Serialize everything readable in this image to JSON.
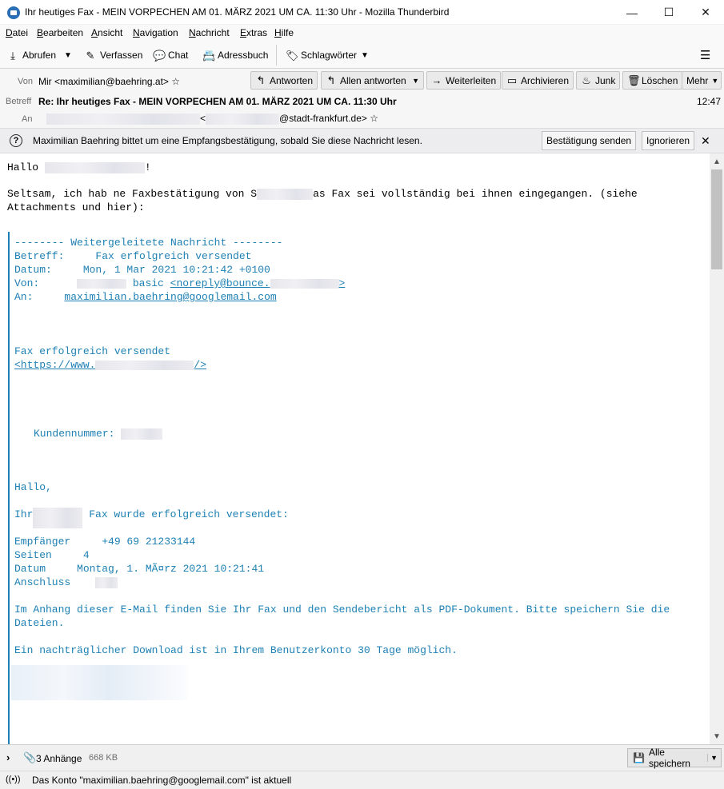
{
  "window": {
    "title": "Ihr heutiges Fax - MEIN VORPECHEN AM 01. MÄRZ 2021 UM CA. 11:30 Uhr - Mozilla Thunderbird",
    "minimize_glyph": "—",
    "maximize_glyph": "☐",
    "close_glyph": "✕"
  },
  "menu": {
    "items": [
      {
        "acc": "D",
        "rest": "atei"
      },
      {
        "acc": "B",
        "rest": "earbeiten"
      },
      {
        "acc": "A",
        "rest": "nsicht"
      },
      {
        "acc": "N",
        "pre": "",
        "rest": "avigation"
      },
      {
        "acc": "N",
        "rest": "achricht"
      },
      {
        "acc": "E",
        "rest": "xtras"
      },
      {
        "acc": "H",
        "rest": "ilfe"
      }
    ]
  },
  "toolbar": {
    "get_mail": "Abrufen",
    "write": "Verfassen",
    "chat": "Chat",
    "address_book": "Adressbuch",
    "tags": "Schlagwörter",
    "menu_glyph": "☰"
  },
  "message_header": {
    "from_label": "Von",
    "from_value": "Mir <maximilian@baehring.at>",
    "subject_label": "Betreff",
    "subject_value": "Re: Ihr heutiges Fax - MEIN VORPECHEN AM 01. MÄRZ 2021 UM CA. 11:30 Uhr",
    "time": "12:47",
    "to_label": "An",
    "to_open": "<",
    "to_suffix": "@stadt-frankfurt.de>",
    "buttons": {
      "reply": "Antworten",
      "reply_all": "Allen antworten",
      "forward": "Weiterleiten",
      "archive": "Archivieren",
      "junk": "Junk",
      "delete": "Löschen",
      "more": "Mehr"
    }
  },
  "notification": {
    "text": "Maximilian Baehring bittet um eine Empfangsbestätigung, sobald Sie diese Nachricht lesen.",
    "send_receipt": "Bestätigung senden",
    "ignore": "Ignorieren"
  },
  "body": {
    "greeting_start": "Hallo",
    "greeting_end": "!",
    "line1_a": "Seltsam, ich hab ne Faxbestätigung von S",
    "line1_b": "as Fax sei vollständig bei ihnen eingegangen. (siehe",
    "line2": "Attachments und hier):",
    "fwd_header": "-------- Weitergeleitete Nachricht --------",
    "fwd_subject": "Betreff:     Fax erfolgreich versendet",
    "fwd_date": "Datum:     Mon, 1 Mar 2021 10:21:42 +0100",
    "fwd_from_label": "Von:",
    "fwd_from_mid": "basic",
    "fwd_from_link_start": "<noreply@bounce.",
    "fwd_from_link_end": ">",
    "fwd_to_label": "An:",
    "fwd_to_link": "maximilian.baehring@googlemail.com",
    "fax_sent": "Fax erfolgreich versendet",
    "url_start": "<https://www.",
    "url_end": "/>",
    "customer_no": "Kundennummer:",
    "hallo": "Hallo,",
    "ihr": "Ihr",
    "fax_ok": "Fax wurde erfolgreich versendet:",
    "recipient": "Empfänger     +49 69 21233144",
    "pages": "Seiten     4",
    "date": "Datum     Montag, 1. MÃ¤rz 2021 10:21:41",
    "connection": "Anschluss",
    "attach_a": "Im Anhang dieser E-Mail finden Sie Ihr Fax und den Sendebericht als PDF-Dokument. Bitte speichern Sie die",
    "attach_b": "Dateien.",
    "download": "Ein nachträglicher Download ist in Ihrem Benutzerkonto 30 Tage möglich."
  },
  "attachments": {
    "count": "3 Anhänge",
    "size": "668 KB",
    "save_all": "Alle speichern"
  },
  "status": {
    "text": "Das Konto \"maximilian.baehring@googlemail.com\" ist aktuell"
  }
}
